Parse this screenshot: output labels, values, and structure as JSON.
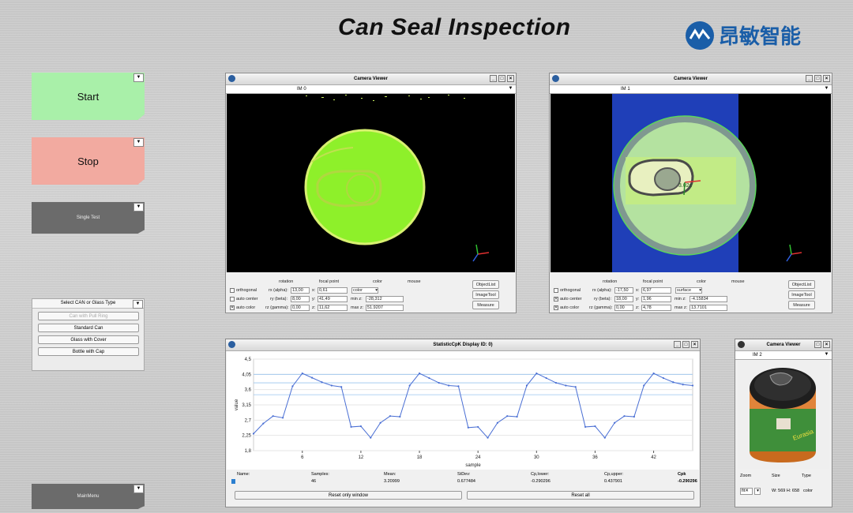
{
  "header": {
    "title": "Can Seal Inspection",
    "logo_text": "昂敏智能"
  },
  "colors": {
    "start": "#a9f0a9",
    "stop": "#f2aaa0",
    "dark_button": "#6b6b6b",
    "accent": "#1a5ea8",
    "lime": "#8ef02a",
    "plot_line": "#4a6fd4"
  },
  "buttons": {
    "start": "Start",
    "stop": "Stop",
    "single_test": "Single Test",
    "main_menu": "MainMenu"
  },
  "can_select": {
    "title": "Select CAN or Glass Type",
    "options": [
      "Can with Pull Ring",
      "Standard Can",
      "Glass with Cover",
      "Bottle with Cap"
    ]
  },
  "viewer1": {
    "title": "Camera Viewer",
    "tab": "IM 0",
    "headers": {
      "rotation": "rotation",
      "focal": "focal point",
      "color": "color",
      "mouse": "mouse"
    },
    "labels": {
      "orthogonal": "orthogonal",
      "auto_center": "auto center",
      "auto_color": "auto color",
      "rx": "rx (alpha):",
      "ry": "ry (beta):",
      "rz": "rz (gamma):",
      "x": "x:",
      "y": "y:",
      "z": "z:",
      "minz": "min z:",
      "maxz": "max z:"
    },
    "values": {
      "rx": "13,00",
      "ry": "8,00",
      "rz": "0,00",
      "x": "0,61",
      "y": "41,49",
      "z": "11,62",
      "color_mode": "color",
      "minz": "-28,312",
      "maxz": "51.9207"
    },
    "checks": {
      "orthogonal": false,
      "auto_center": false,
      "auto_color": true
    },
    "side_buttons": [
      "ObjectList",
      "ImageTool",
      "Measure"
    ]
  },
  "viewer2": {
    "title": "Camera Viewer",
    "tab": "IM 1",
    "headers": {
      "rotation": "rotation",
      "focal": "focal point",
      "color": "color",
      "mouse": "mouse"
    },
    "labels": {
      "orthogonal": "orthogonal",
      "auto_center": "auto center",
      "auto_color": "auto color",
      "rx": "rx (alpha):",
      "ry": "ry (beta):",
      "rz": "rz (gamma):",
      "x": "x:",
      "y": "y:",
      "z": "z:",
      "minz": "min z:",
      "maxz": "max z:"
    },
    "values": {
      "rx": "-17,50",
      "ry": "18,00",
      "rz": "0,00",
      "x": "6,97",
      "y": "1,96",
      "z": "4,78",
      "color_mode": "surface",
      "minz": "-4.15834",
      "maxz": "13.7101"
    },
    "checks": {
      "orthogonal": false,
      "auto_center": true,
      "auto_color": true
    },
    "side_buttons": [
      "ObjectList",
      "ImageTool",
      "Measure"
    ]
  },
  "viewer3": {
    "title": "Camera Viewer",
    "tab": "IM 2",
    "labels": {
      "zoom": "Zoom",
      "size": "Size",
      "type": "Type",
      "fit": "fit"
    },
    "size_value": "W: 569  H: 658",
    "type_value": "color"
  },
  "stat": {
    "title": "StatisticCpK Display  ID: 0)",
    "columns": [
      "Name:",
      "Samples:",
      "Mean:",
      "StDev:",
      "Cp,lower:",
      "Cp,upper:",
      "Cpk"
    ],
    "row": [
      "",
      "46",
      "3.20999",
      "0.677484",
      "-0.290296",
      "0.437901",
      "-0.290296"
    ],
    "reset_window": "Reset only window",
    "reset_all": "Reset all"
  },
  "chart_data": {
    "type": "line",
    "xlabel": "sample",
    "ylabel": "value",
    "xlim": [
      1,
      46
    ],
    "ylim": [
      1.8,
      4.5
    ],
    "yticks": [
      "4,5",
      "4,05",
      "3,6",
      "3,15",
      "2,7",
      "2,25",
      "1,8"
    ],
    "xticks": [
      "6",
      "12",
      "18",
      "24",
      "30",
      "36",
      "42"
    ],
    "series": [
      {
        "x": [
          1,
          2,
          3,
          4,
          5,
          6,
          7,
          8,
          9,
          10,
          11,
          12,
          13,
          14,
          15,
          16,
          17,
          18,
          19,
          20,
          21,
          22,
          23,
          24,
          25,
          26,
          27,
          28,
          29,
          30,
          31,
          32,
          33,
          34,
          35,
          36,
          37,
          38,
          39,
          40,
          41,
          42,
          43,
          44,
          45,
          46
        ],
        "values": [
          2.3,
          2.6,
          2.82,
          2.77,
          3.7,
          4.08,
          3.95,
          3.82,
          3.72,
          3.68,
          2.5,
          2.52,
          2.18,
          2.62,
          2.82,
          2.8,
          3.72,
          4.08,
          3.94,
          3.8,
          3.72,
          3.7,
          2.48,
          2.5,
          2.18,
          2.62,
          2.82,
          2.8,
          3.72,
          4.08,
          3.94,
          3.8,
          3.72,
          3.68,
          2.5,
          2.52,
          2.18,
          2.62,
          2.82,
          2.8,
          3.72,
          4.08,
          3.94,
          3.82,
          3.75,
          3.72
        ]
      }
    ]
  }
}
